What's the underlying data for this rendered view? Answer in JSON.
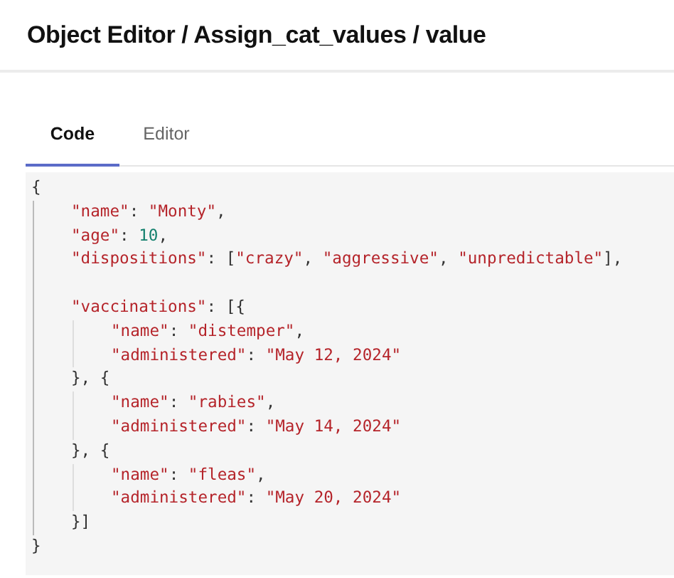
{
  "header": {
    "title": "Object Editor / Assign_cat_values / value"
  },
  "tabs": [
    {
      "label": "Code",
      "selected": true
    },
    {
      "label": "Editor",
      "selected": false
    }
  ],
  "code": {
    "lines": [
      {
        "kind": "line",
        "tokens": [
          {
            "kind": "punct",
            "text": "{"
          }
        ]
      },
      {
        "kind": "block",
        "children": [
          {
            "kind": "line",
            "tokens": [
              {
                "kind": "string",
                "text": "\"name\""
              },
              {
                "kind": "punct",
                "text": ": "
              },
              {
                "kind": "string",
                "text": "\"Monty\""
              },
              {
                "kind": "punct",
                "text": ","
              }
            ]
          },
          {
            "kind": "line",
            "tokens": [
              {
                "kind": "string",
                "text": "\"age\""
              },
              {
                "kind": "punct",
                "text": ": "
              },
              {
                "kind": "number",
                "text": "10"
              },
              {
                "kind": "punct",
                "text": ","
              }
            ]
          },
          {
            "kind": "line",
            "tokens": [
              {
                "kind": "string",
                "text": "\"dispositions\""
              },
              {
                "kind": "punct",
                "text": ": ["
              },
              {
                "kind": "string",
                "text": "\"crazy\""
              },
              {
                "kind": "punct",
                "text": ", "
              },
              {
                "kind": "string",
                "text": "\"aggressive\""
              },
              {
                "kind": "punct",
                "text": ", "
              },
              {
                "kind": "string",
                "text": "\"unpredictable\""
              },
              {
                "kind": "punct",
                "text": "],"
              }
            ]
          },
          {
            "kind": "blank"
          },
          {
            "kind": "line",
            "tokens": [
              {
                "kind": "string",
                "text": "\"vaccinations\""
              },
              {
                "kind": "punct",
                "text": ": [{"
              }
            ]
          },
          {
            "kind": "block",
            "children": [
              {
                "kind": "line",
                "tokens": [
                  {
                    "kind": "string",
                    "text": "\"name\""
                  },
                  {
                    "kind": "punct",
                    "text": ": "
                  },
                  {
                    "kind": "string",
                    "text": "\"distemper\""
                  },
                  {
                    "kind": "punct",
                    "text": ","
                  }
                ]
              },
              {
                "kind": "line",
                "tokens": [
                  {
                    "kind": "string",
                    "text": "\"administered\""
                  },
                  {
                    "kind": "punct",
                    "text": ": "
                  },
                  {
                    "kind": "string",
                    "text": "\"May 12, 2024\""
                  }
                ]
              }
            ]
          },
          {
            "kind": "line",
            "tokens": [
              {
                "kind": "punct",
                "text": "}, {"
              }
            ]
          },
          {
            "kind": "block",
            "children": [
              {
                "kind": "line",
                "tokens": [
                  {
                    "kind": "string",
                    "text": "\"name\""
                  },
                  {
                    "kind": "punct",
                    "text": ": "
                  },
                  {
                    "kind": "string",
                    "text": "\"rabies\""
                  },
                  {
                    "kind": "punct",
                    "text": ","
                  }
                ]
              },
              {
                "kind": "line",
                "tokens": [
                  {
                    "kind": "string",
                    "text": "\"administered\""
                  },
                  {
                    "kind": "punct",
                    "text": ": "
                  },
                  {
                    "kind": "string",
                    "text": "\"May 14, 2024\""
                  }
                ]
              }
            ]
          },
          {
            "kind": "line",
            "tokens": [
              {
                "kind": "punct",
                "text": "}, {"
              }
            ]
          },
          {
            "kind": "block",
            "children": [
              {
                "kind": "line",
                "tokens": [
                  {
                    "kind": "string",
                    "text": "\"name\""
                  },
                  {
                    "kind": "punct",
                    "text": ": "
                  },
                  {
                    "kind": "string",
                    "text": "\"fleas\""
                  },
                  {
                    "kind": "punct",
                    "text": ","
                  }
                ]
              },
              {
                "kind": "line",
                "tokens": [
                  {
                    "kind": "string",
                    "text": "\"administered\""
                  },
                  {
                    "kind": "punct",
                    "text": ": "
                  },
                  {
                    "kind": "string",
                    "text": "\"May 20, 2024\""
                  }
                ]
              }
            ]
          },
          {
            "kind": "line",
            "tokens": [
              {
                "kind": "punct",
                "text": "}]"
              }
            ]
          }
        ]
      },
      {
        "kind": "line",
        "tokens": [
          {
            "kind": "punct",
            "text": "}"
          }
        ]
      }
    ]
  }
}
